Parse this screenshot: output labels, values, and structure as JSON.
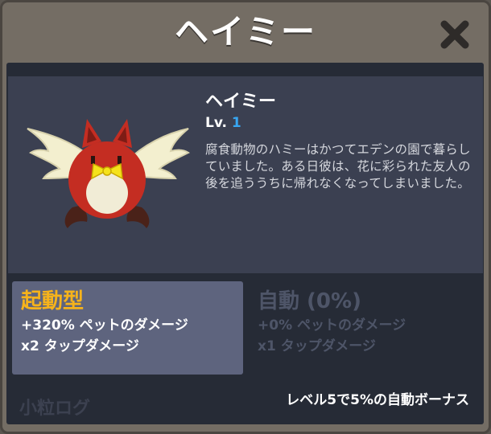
{
  "window": {
    "title": "ヘイミー"
  },
  "pet": {
    "name": "ヘイミー",
    "level_label": "Lv.",
    "level_value": "1",
    "description": "腐食動物のハミーはかつてエデンの園で暮らしていました。ある日彼は、花に彩られた友人の後を追ううちに帰れなくなってしまいました。",
    "image_icon": "winged-red-creature-with-yellow-bow"
  },
  "active_card": {
    "title": "起動型",
    "line1": "+320% ペットのダメージ",
    "line2": "x2 タップダメージ"
  },
  "passive_card": {
    "title": "自動 (0%)",
    "line1": "+0% ペットのダメージ",
    "line2": "x1 タップダメージ"
  },
  "footer": {
    "watermark": "小粒ログ",
    "bonus_text": "レベル5で5%の自動ボーナス"
  },
  "colors": {
    "frame": "#746d64",
    "panel_dark": "#262b36",
    "info_bg": "#3b4051",
    "active_card_bg": "#5e647e",
    "accent_orange": "#f6b31b",
    "accent_blue": "#38a7f2",
    "disabled_text": "#4e5568"
  }
}
